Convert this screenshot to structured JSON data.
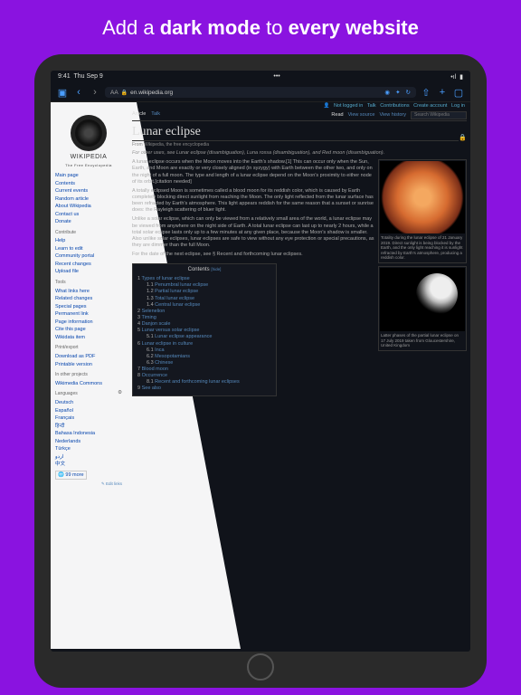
{
  "hero": {
    "pre": "Add a ",
    "b1": "dark mode",
    "mid": " to ",
    "b2": "every website"
  },
  "status": {
    "time": "9:41",
    "date": "Thu Sep 9",
    "dots": "•••"
  },
  "toolbar": {
    "url": "en.wikipedia.org",
    "aa": "AA"
  },
  "user_row": {
    "not_logged": "Not logged in",
    "talk": "Talk",
    "contrib": "Contributions",
    "create": "Create account",
    "login": "Log in"
  },
  "logo": {
    "name": "WIKIPEDIA",
    "tagline": "The Free Encyclopedia"
  },
  "sidebar": {
    "main": [
      "Main page",
      "Contents",
      "Current events",
      "Random article",
      "About Wikipedia",
      "Contact us",
      "Donate"
    ],
    "contribute_h": "Contribute",
    "contribute": [
      "Help",
      "Learn to edit",
      "Community portal",
      "Recent changes",
      "Upload file"
    ],
    "tools_h": "Tools",
    "tools": [
      "What links here",
      "Related changes",
      "Special pages",
      "Permanent link",
      "Page information",
      "Cite this page",
      "Wikidata item"
    ],
    "print_h": "Print/export",
    "print": [
      "Download as PDF",
      "Printable version"
    ],
    "other_h": "In other projects",
    "other": [
      "Wikimedia Commons"
    ],
    "lang_h": "Languages",
    "langs": [
      "Deutsch",
      "Español",
      "Français",
      "हिन्दी",
      "Bahasa Indonesia",
      "Nederlands",
      "Türkçe",
      "اردو",
      "中文"
    ],
    "more": "99 more",
    "edit_links": "Edit links"
  },
  "tabs": {
    "article": "Article",
    "talk": "Talk",
    "read": "Read",
    "viewsrc": "View source",
    "history": "View history",
    "search_ph": "Search Wikipedia"
  },
  "article": {
    "title": "Lunar eclipse",
    "from": "From Wikipedia, the free encyclopedia",
    "hatnote": "For other uses, see Lunar eclipse (disambiguation), Luna rossa (disambiguation), and Red moon (disambiguation).",
    "p1": "A lunar eclipse occurs when the Moon moves into the Earth's shadow.[1] This can occur only when the Sun, Earth, and Moon are exactly or very closely aligned (in syzygy) with Earth between the other two, and only on the night of a full moon. The type and length of a lunar eclipse depend on the Moon's proximity to either node of its orbit.[citation needed]",
    "p2": "A totally eclipsed Moon is sometimes called a blood moon for its reddish color, which is caused by Earth completely blocking direct sunlight from reaching the Moon. The only light reflected from the lunar surface has been refracted by Earth's atmosphere. This light appears reddish for the same reason that a sunset or sunrise does: the Rayleigh scattering of bluer light.",
    "p3": "Unlike a solar eclipse, which can only be viewed from a relatively small area of the world, a lunar eclipse may be viewed from anywhere on the night side of Earth. A total lunar eclipse can last up to nearly 2 hours, while a total solar eclipse lasts only up to a few minutes at any given place, because the Moon's shadow is smaller. Also unlike solar eclipses, lunar eclipses are safe to view without any eye protection or special precautions, as they are dimmer than the full Moon.",
    "p4": "For the date of the next eclipse, see § Recent and forthcoming lunar eclipses.",
    "cap1": "Totality during the lunar eclipse of 21 January 2019. Direct sunlight is being blocked by the Earth, and the only light reaching it is sunlight refracted by Earth's atmosphere, producing a reddish color.",
    "cap2": "Latter phases of the partial lunar eclipse on 17 July 2019 taken from Gloucestershire, United Kingdom"
  },
  "toc": {
    "title": "Contents",
    "hide": "[hide]",
    "items": [
      {
        "n": "1",
        "t": "Types of lunar eclipse",
        "sub": [
          {
            "n": "1.1",
            "t": "Penumbral lunar eclipse"
          },
          {
            "n": "1.2",
            "t": "Partial lunar eclipse"
          },
          {
            "n": "1.3",
            "t": "Total lunar eclipse"
          },
          {
            "n": "1.4",
            "t": "Central lunar eclipse"
          }
        ]
      },
      {
        "n": "2",
        "t": "Selenelion"
      },
      {
        "n": "3",
        "t": "Timing"
      },
      {
        "n": "4",
        "t": "Danjon scale"
      },
      {
        "n": "5",
        "t": "Lunar versus solar eclipse",
        "sub": [
          {
            "n": "5.1",
            "t": "Lunar eclipse appearance"
          }
        ]
      },
      {
        "n": "6",
        "t": "Lunar eclipse in culture",
        "sub": [
          {
            "n": "6.1",
            "t": "Inca"
          },
          {
            "n": "6.2",
            "t": "Mesopotamians"
          },
          {
            "n": "6.3",
            "t": "Chinese"
          }
        ]
      },
      {
        "n": "7",
        "t": "Blood moon"
      },
      {
        "n": "8",
        "t": "Occurrence",
        "sub": [
          {
            "n": "8.1",
            "t": "Recent and forthcoming lunar eclipses"
          }
        ]
      },
      {
        "n": "9",
        "t": "See also"
      }
    ]
  }
}
